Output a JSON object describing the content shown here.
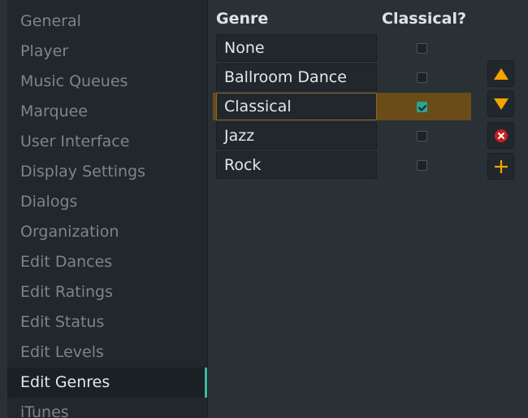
{
  "sidebar": {
    "items": [
      {
        "label": "General"
      },
      {
        "label": "Player"
      },
      {
        "label": "Music Queues"
      },
      {
        "label": "Marquee"
      },
      {
        "label": "User Interface"
      },
      {
        "label": "Display Settings"
      },
      {
        "label": "Dialogs"
      },
      {
        "label": "Organization"
      },
      {
        "label": "Edit Dances"
      },
      {
        "label": "Edit Ratings"
      },
      {
        "label": "Edit Status"
      },
      {
        "label": "Edit Levels"
      },
      {
        "label": "Edit Genres"
      },
      {
        "label": "iTunes"
      }
    ],
    "selected": "Edit Genres"
  },
  "table": {
    "headers": {
      "genre": "Genre",
      "classical": "Classical?"
    },
    "rows": [
      {
        "genre": "None",
        "classical": false
      },
      {
        "genre": "Ballroom Dance",
        "classical": false
      },
      {
        "genre": "Classical",
        "classical": true
      },
      {
        "genre": "Jazz",
        "classical": false
      },
      {
        "genre": "Rock",
        "classical": false
      }
    ],
    "selected_row": "Classical"
  },
  "buttons": {
    "move_up": "arrow-up-icon",
    "move_down": "arrow-down-icon",
    "remove": "remove-icon",
    "add": "plus-icon"
  },
  "colors": {
    "accent_teal": "#3fb8a0",
    "selection_orange": "#6a4c18",
    "arrow_orange": "#f5a300",
    "remove_red": "#c81e1e"
  }
}
